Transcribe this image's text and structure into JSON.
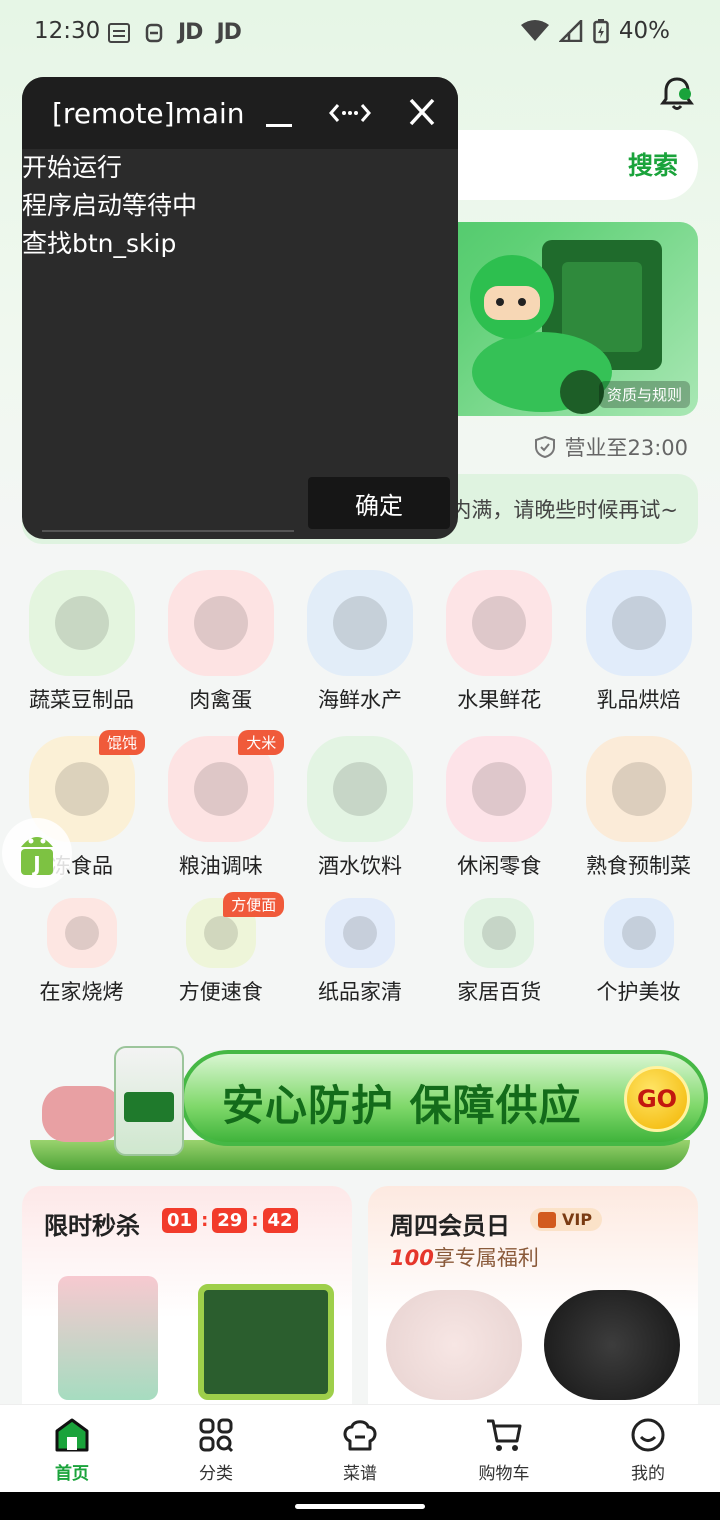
{
  "status_bar": {
    "time": "12:30",
    "app_icons": [
      "JD",
      "JD"
    ],
    "battery": "40%"
  },
  "search": {
    "button_label": "搜索"
  },
  "banner": {
    "rules_label": "资质与规则"
  },
  "store": {
    "hours": "营业至23:00",
    "notice": "内满，请晚些时候再试~"
  },
  "categories": [
    {
      "label": "蔬菜豆制品",
      "badge": "",
      "icon": "vegetable-icon",
      "color": "#e4f5df"
    },
    {
      "label": "肉禽蛋",
      "badge": "",
      "icon": "meat-icon",
      "color": "#fde3e3"
    },
    {
      "label": "海鲜水产",
      "badge": "",
      "icon": "seafood-icon",
      "color": "#e2edf8"
    },
    {
      "label": "水果鲜花",
      "badge": "",
      "icon": "fruit-icon",
      "color": "#fde4e6"
    },
    {
      "label": "乳品烘焙",
      "badge": "",
      "icon": "dairy-icon",
      "color": "#e1ecfa"
    },
    {
      "label": "冻食品",
      "badge": "馄饨",
      "icon": "frozen-food-icon",
      "color": "#fbf0d6"
    },
    {
      "label": "粮油调味",
      "badge": "大米",
      "icon": "oil-icon",
      "color": "#fde3e3"
    },
    {
      "label": "酒水饮料",
      "badge": "",
      "icon": "drink-icon",
      "color": "#e3f4e3"
    },
    {
      "label": "休闲零食",
      "badge": "",
      "icon": "snack-icon",
      "color": "#fde3e8"
    },
    {
      "label": "熟食预制菜",
      "badge": "",
      "icon": "cooked-food-icon",
      "color": "#fbebd8"
    },
    {
      "label": "在家烧烤",
      "badge": "",
      "icon": "bbq-icon",
      "color": "#fde6e2"
    },
    {
      "label": "方便速食",
      "badge": "方便面",
      "icon": "instant-food-icon",
      "color": "#eef5d9"
    },
    {
      "label": "纸品家清",
      "badge": "",
      "icon": "tissue-icon",
      "color": "#e3ecfa"
    },
    {
      "label": "家居百货",
      "badge": "",
      "icon": "household-icon",
      "color": "#e2f3e3"
    },
    {
      "label": "个护美妆",
      "badge": "",
      "icon": "personal-care-icon",
      "color": "#e1ecfa"
    }
  ],
  "promo": {
    "text": "安心防护 保障供应",
    "go_label": "GO"
  },
  "flash_sale": {
    "title": "限时秒杀",
    "hours": "01",
    "minutes": "29",
    "seconds": "42"
  },
  "member_day": {
    "title": "周四会员日",
    "vip_label": "VIP",
    "subtitle_num": "100",
    "subtitle": "享专属福利"
  },
  "bottom_nav": [
    {
      "label": "首页",
      "icon": "home-icon",
      "active": true
    },
    {
      "label": "分类",
      "icon": "grid-icon",
      "active": false
    },
    {
      "label": "菜谱",
      "icon": "chef-hat-icon",
      "active": false
    },
    {
      "label": "购物车",
      "icon": "cart-icon",
      "active": false
    },
    {
      "label": "我的",
      "icon": "profile-icon",
      "active": false
    }
  ],
  "remote_window": {
    "title": "[remote]main",
    "log_lines": [
      "开始运行",
      "程序启动等待中",
      "查找btn_skip"
    ],
    "ok_label": "确定"
  },
  "colors": {
    "brand_green": "#1aa33b",
    "sale_red": "#f23b2b",
    "overlay_bg": "#2b2b2b"
  }
}
